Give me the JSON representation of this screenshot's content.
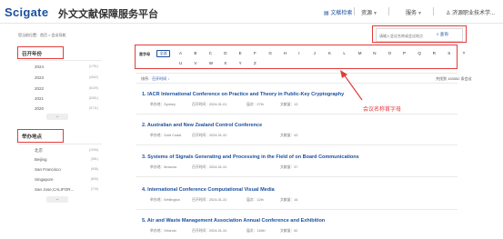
{
  "header": {
    "logo": "Scigate",
    "title": "外文文献保障服务平台",
    "nav": [
      {
        "label": "文献检索"
      },
      {
        "label": "资源"
      },
      {
        "label": "服务"
      },
      {
        "label": "济源职业技术学..."
      }
    ]
  },
  "breadcrumb": "您当前位置：首页 > 会议导航",
  "search": {
    "placeholder": "请输入会议名称或会议地点",
    "button_label": "查询"
  },
  "sidebar": {
    "year_title": "召开年份",
    "years": [
      {
        "label": "2024",
        "count": "(1751)"
      },
      {
        "label": "2023",
        "count": "(4062)"
      },
      {
        "label": "2022",
        "count": "(5109)"
      },
      {
        "label": "2021",
        "count": "(5351)"
      },
      {
        "label": "2020",
        "count": "(5711)"
      }
    ],
    "place_title": "举办地点",
    "places": [
      {
        "label": "北京",
        "count": "(1096)"
      },
      {
        "label": "Beijing",
        "count": "(981)"
      },
      {
        "label": "San Francisco",
        "count": "(908)"
      },
      {
        "label": "Singapore",
        "count": "(839)"
      },
      {
        "label": "San Jose,CALIFOR...",
        "count": "(719)"
      }
    ],
    "more_label": "⌄"
  },
  "alphabet": {
    "label": "首字母",
    "all_label": "全部",
    "row1": [
      "A",
      "B",
      "C",
      "D",
      "E",
      "F",
      "G",
      "H",
      "I",
      "J",
      "K",
      "L",
      "M",
      "N",
      "O",
      "P",
      "Q",
      "R",
      "S",
      "T"
    ],
    "row2": [
      "U",
      "V",
      "W",
      "X",
      "Y",
      "Z"
    ]
  },
  "toolbar": {
    "ops_label": "排序:",
    "sort_label": "召开时间 ↓",
    "total": "共找到 153552 条会议"
  },
  "annotation": "会议名称首字母",
  "results": [
    {
      "title": "1. IACR International Conference on Practice and Theory in Public-Key Cryptography",
      "place": "举办地：Sydney",
      "date": "召开时间：2024-01-01",
      "session": "届次：27th",
      "count": "文献量：13"
    },
    {
      "title": "2. Australian and New Zealand Control Conference",
      "place": "举办地：Gold Coast",
      "date": "召开时间：2024-01-31",
      "session": "",
      "count": "文献量：43"
    },
    {
      "title": "3. Systems of Signals Generating and Processing in the Field of on Board Communications",
      "place": "举办地：Moscow",
      "date": "召开时间：2024-01-31",
      "session": "",
      "count": "文献量：37"
    },
    {
      "title": "4. International Conference Computational Visual Media",
      "place": "举办地：Wellington",
      "date": "召开时间：2024-01-31",
      "session": "届次：12th",
      "count": "文献量：16"
    },
    {
      "title": "5. Air and Waste Management Association Annual Conference and Exhibition",
      "place": "举办地：Orlando",
      "date": "召开时间：2024-01-31",
      "session": "届次：116th",
      "count": "文献量：52"
    }
  ]
}
